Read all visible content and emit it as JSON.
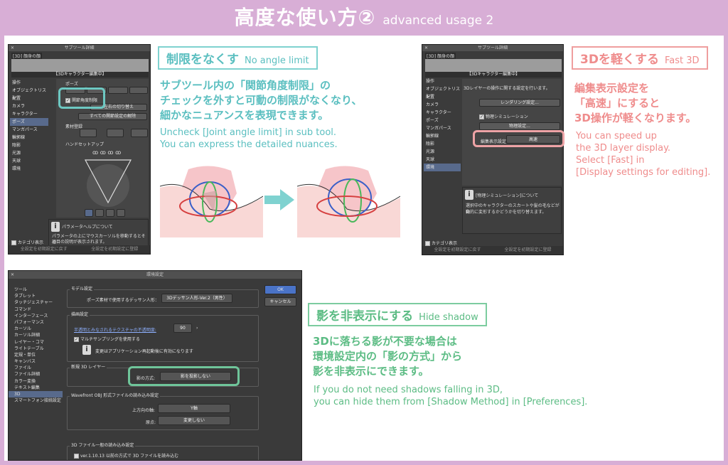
{
  "page": {
    "title_jp": "高度な使い方②",
    "title_en": "advanced usage 2"
  },
  "sections": {
    "no_angle": {
      "header_jp": "制限をなくす",
      "header_en": "No angle limit",
      "body_jp": [
        "サブツール内の「関節角度制限」の",
        "チェックを外すと可動の制限がなくなり、",
        "細かなニュアンスを表現できます。"
      ],
      "body_en": [
        "Uncheck [Joint angle limit] in sub tool.",
        "You can express the detailed nuances."
      ]
    },
    "fast3d": {
      "header_jp": "3Dを軽くする",
      "header_en": "Fast 3D",
      "body_jp": [
        "編集表示設定を",
        "「高速」にすると",
        "3D操作が軽くなります。"
      ],
      "body_en": [
        "You can speed up",
        "the 3D layer display.",
        "Select [Fast] in",
        "[Display settings for editing]."
      ]
    },
    "hide_shadow": {
      "header_jp": "影を非表示にする",
      "header_en": "Hide shadow",
      "body_jp": [
        "3Dに落ちる影が不要な場合は",
        "環境設定内の「影の方式」から",
        "影を非表示にできます。"
      ],
      "body_en": [
        "If you do not need shadows falling in 3D,",
        "you can hide them from [Shadow Method] in [Preferences]."
      ]
    }
  },
  "subtool_panel_1": {
    "title": "サブツール詳細",
    "tag": "[3D] 顔身の顔",
    "editing": "【3Dキャラクター編集中】",
    "categories": [
      "操作",
      "オブジェクトリスト",
      "配置",
      "カメラ",
      "キャラクター",
      "ポーズ",
      "マンガパース",
      "輪郭線",
      "陰影",
      "光源",
      "天球",
      "環境"
    ],
    "selected_category": "ポーズ",
    "pose_label": "ポーズ",
    "joint_limit_label": "関節角度制限",
    "toggle_label": "左右の切り替え",
    "reset_all_label": "すべての関節設定の解除",
    "material_label": "素材登録",
    "hand_label": "ハンドセットアップ",
    "help_title": "パラメータヘルプについて",
    "help_text": [
      "パラメータの上にマウスカーソルを移動するとその",
      "項目の説明が表示されます。"
    ],
    "category_display": "カテゴリ表示",
    "reset_default": "全設定を初期設定に戻す",
    "register_default": "全設定を初期設定に登録"
  },
  "subtool_panel_2": {
    "title": "サブツール詳細",
    "tag": "[3D] 顔身の顔",
    "editing": "【3Dキャラクター編集中】",
    "categories": [
      "操作",
      "オブジェクトリスト",
      "配置",
      "カメラ",
      "キャラクター",
      "ポーズ",
      "マンガパース",
      "輪郭線",
      "陰影",
      "光源",
      "天球",
      "環境"
    ],
    "selected_category": "環境",
    "layer_desc": "3Dレイヤーの操作に関する設定を行います。",
    "render_btn": "レンダリング設定...",
    "physics_label": "物理シミュレーション",
    "physics_btn": "物理設定...",
    "display_label": "編集表示設定",
    "display_value": "高速",
    "info_title": "[物理シミュレーション]について",
    "info_text": [
      "選択中のキャラクターのスカートや髪の毛などが自",
      "動的に変形するかどうかを切り替えます。"
    ],
    "category_display": "カテゴリ表示",
    "reset_default": "全設定を初期設定に戻す",
    "register_default": "全設定を初期設定に登録"
  },
  "preferences": {
    "title": "環境設定",
    "sidebar": [
      "ツール",
      "タブレット",
      "タッチジェスチャー",
      "コマンド",
      "インターフェース",
      "パフォーマンス",
      "カーソル",
      "カーソル詳細",
      "レイヤー・コマ",
      "ライトテーブル",
      "定規・単位",
      "キャンバス",
      "ファイル",
      "ファイル詳細",
      "カラー変換",
      "テキスト編集",
      "3D",
      "スマートフォン接続設定"
    ],
    "selected": "3D",
    "model_group": "モデル設定",
    "pose_material_label": "ポーズ素材で使用するデッサン人形：",
    "pose_material_value": "3Dデッサン人形-Ver.2（男性）",
    "ok": "OK",
    "cancel": "キャンセル",
    "render_group": "描画設定",
    "opacity_label": "半透明とみなされるテクスチャの不透明度:",
    "opacity_value": "90",
    "multisampling_label": "マルチサンプリングを使用する",
    "restart_note": "変更はアプリケーション再起動後に有効になります",
    "new3d_group": "新規 3D レイヤー",
    "shadow_label": "影の方式:",
    "shadow_value": "影を投影しない",
    "obj_group": "Wavefront OBJ 形式ファイルの読み込み設定",
    "up_axis_label": "上方向の軸:",
    "up_axis_value": "Y軸",
    "origin_label": "原点:",
    "origin_value": "変更しない",
    "general_group": "3D ファイル一般の読み込み設定",
    "legacy_label": "ver.1.10.13 以前の方式で 3D ファイルを読み込む"
  },
  "colors": {
    "frame": "#d8aed6",
    "teal": "#5bbfc0",
    "pink": "#ef8c8c",
    "green": "#5cbc84",
    "arrow": "#7fd2d0"
  }
}
